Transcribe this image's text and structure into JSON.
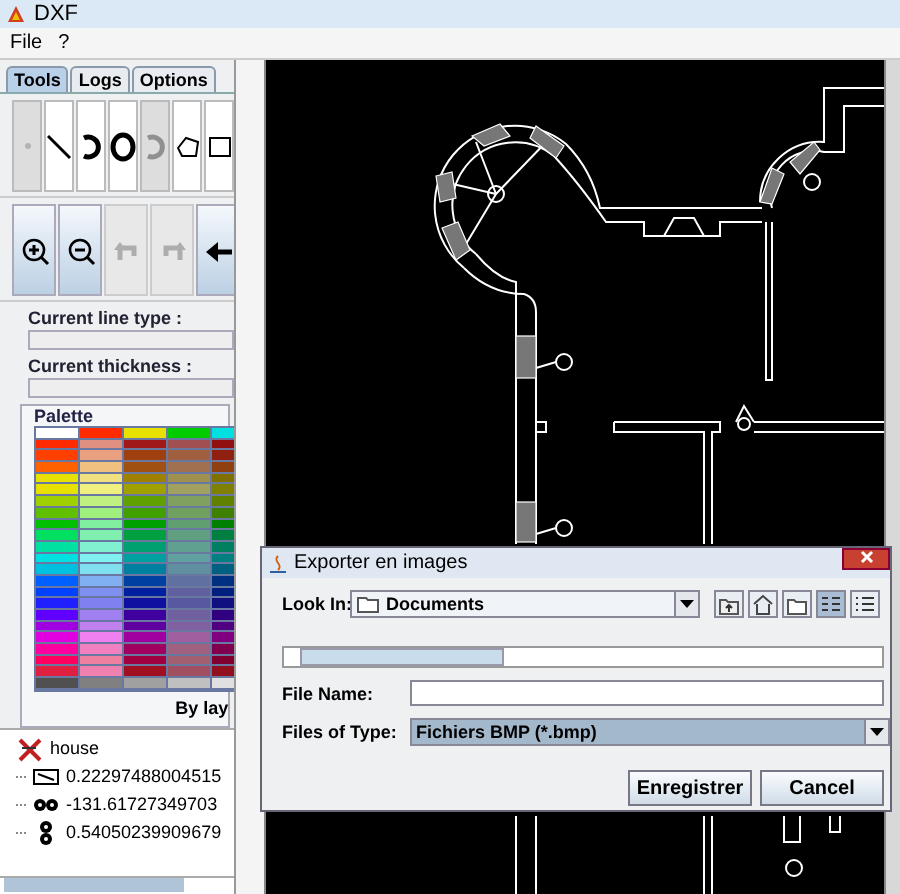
{
  "window": {
    "title": "DXF"
  },
  "menu": [
    {
      "label": "File"
    },
    {
      "label": "?"
    }
  ],
  "tabs": [
    {
      "label": "Tools",
      "selected": true
    },
    {
      "label": "Logs",
      "selected": false
    },
    {
      "label": "Options",
      "selected": false
    }
  ],
  "draw_tools": [
    {
      "kind": "point",
      "disabled": true
    },
    {
      "kind": "line",
      "disabled": false
    },
    {
      "kind": "arc",
      "disabled": false
    },
    {
      "kind": "circle",
      "disabled": false
    },
    {
      "kind": "arc",
      "disabled": true
    },
    {
      "kind": "polygon",
      "disabled": false
    },
    {
      "kind": "rectangle",
      "disabled": false
    }
  ],
  "view_tools": [
    {
      "kind": "zoom-in",
      "disabled": false
    },
    {
      "kind": "zoom-out",
      "disabled": false
    },
    {
      "kind": "undo",
      "disabled": true
    },
    {
      "kind": "redo",
      "disabled": true
    },
    {
      "kind": "arrow",
      "disabled": false
    }
  ],
  "properties": [
    {
      "label": "Current line type :"
    },
    {
      "label": "Current thickness :"
    }
  ],
  "palette": {
    "title": "Palette",
    "footer": "By lay",
    "rows": [
      [
        {
          "color": "#ffffff"
        },
        {
          "color": "#ff2a00"
        },
        {
          "color": "#e8e000"
        },
        {
          "color": "#00cc00"
        },
        {
          "color": "#00e0e0"
        }
      ],
      [
        {
          "color": "#ff2a00"
        },
        {
          "color": "#e09080"
        },
        {
          "color": "#a01818"
        },
        {
          "color": "#a05050"
        },
        {
          "color": "#901010"
        }
      ],
      [
        {
          "color": "#ff4000"
        },
        {
          "color": "#e8a080"
        },
        {
          "color": "#a04010"
        },
        {
          "color": "#a06040"
        },
        {
          "color": "#902010"
        }
      ],
      [
        {
          "color": "#ff6000"
        },
        {
          "color": "#f0c080"
        },
        {
          "color": "#a05010"
        },
        {
          "color": "#a07050"
        },
        {
          "color": "#904010"
        }
      ],
      [
        {
          "color": "#e8e000"
        },
        {
          "color": "#f0e080"
        },
        {
          "color": "#a08000"
        },
        {
          "color": "#a09050"
        },
        {
          "color": "#807000"
        }
      ],
      [
        {
          "color": "#e8e000"
        },
        {
          "color": "#f0f080"
        },
        {
          "color": "#a0a000"
        },
        {
          "color": "#a0a060"
        },
        {
          "color": "#808000"
        }
      ],
      [
        {
          "color": "#a0d000"
        },
        {
          "color": "#c0f080"
        },
        {
          "color": "#60a000"
        },
        {
          "color": "#80a060"
        },
        {
          "color": "#608000"
        }
      ],
      [
        {
          "color": "#60c000"
        },
        {
          "color": "#a0f080"
        },
        {
          "color": "#40a000"
        },
        {
          "color": "#70a060"
        },
        {
          "color": "#408000"
        }
      ],
      [
        {
          "color": "#00c000"
        },
        {
          "color": "#80f0a0"
        },
        {
          "color": "#00a000"
        },
        {
          "color": "#60a070"
        },
        {
          "color": "#008000"
        }
      ],
      [
        {
          "color": "#00e060"
        },
        {
          "color": "#80f0b0"
        },
        {
          "color": "#00a040"
        },
        {
          "color": "#60a080"
        },
        {
          "color": "#008040"
        }
      ],
      [
        {
          "color": "#00e0a0"
        },
        {
          "color": "#80f0d0"
        },
        {
          "color": "#00a070"
        },
        {
          "color": "#60a090"
        },
        {
          "color": "#008060"
        }
      ],
      [
        {
          "color": "#00e0e0"
        },
        {
          "color": "#80f0f0"
        },
        {
          "color": "#00a0a0"
        },
        {
          "color": "#60a0a0"
        },
        {
          "color": "#008080"
        }
      ],
      [
        {
          "color": "#00c0e0"
        },
        {
          "color": "#80e0f0"
        },
        {
          "color": "#0080a0"
        },
        {
          "color": "#6090a0"
        },
        {
          "color": "#006080"
        }
      ],
      [
        {
          "color": "#0060ff"
        },
        {
          "color": "#80b0f0"
        },
        {
          "color": "#0040a0"
        },
        {
          "color": "#6070a0"
        },
        {
          "color": "#003080"
        }
      ],
      [
        {
          "color": "#0040ff"
        },
        {
          "color": "#8090f0"
        },
        {
          "color": "#0020a0"
        },
        {
          "color": "#6060a0"
        },
        {
          "color": "#002080"
        }
      ],
      [
        {
          "color": "#2020ff"
        },
        {
          "color": "#8080f0"
        },
        {
          "color": "#1010a0"
        },
        {
          "color": "#5858a0"
        },
        {
          "color": "#101080"
        }
      ],
      [
        {
          "color": "#6000ff"
        },
        {
          "color": "#a080f0"
        },
        {
          "color": "#4000a0"
        },
        {
          "color": "#7060a0"
        },
        {
          "color": "#300080"
        }
      ],
      [
        {
          "color": "#a000e0"
        },
        {
          "color": "#c080f0"
        },
        {
          "color": "#6000a0"
        },
        {
          "color": "#8060a0"
        },
        {
          "color": "#500080"
        }
      ],
      [
        {
          "color": "#e000e0"
        },
        {
          "color": "#f080f0"
        },
        {
          "color": "#a000a0"
        },
        {
          "color": "#a060a0"
        },
        {
          "color": "#800080"
        }
      ],
      [
        {
          "color": "#ff00a0"
        },
        {
          "color": "#f080c0"
        },
        {
          "color": "#a00060"
        },
        {
          "color": "#a06080"
        },
        {
          "color": "#800050"
        }
      ],
      [
        {
          "color": "#ff0060"
        },
        {
          "color": "#f080a0"
        },
        {
          "color": "#a00040"
        },
        {
          "color": "#a06070"
        },
        {
          "color": "#800030"
        }
      ],
      [
        {
          "color": "#e02040"
        },
        {
          "color": "#f080b0"
        },
        {
          "color": "#a01020"
        },
        {
          "color": "#a05060"
        },
        {
          "color": "#901020"
        }
      ],
      [
        {
          "color": "#505050"
        },
        {
          "color": "#808080"
        },
        {
          "color": "#a0a0a0"
        },
        {
          "color": "#c0c0c0"
        },
        {
          "color": "#e0e0e0"
        }
      ]
    ]
  },
  "tree": {
    "label": "house",
    "children": [
      {
        "kind": "rect",
        "label": "0.22297488004515"
      },
      {
        "kind": "chain",
        "label": "-131.61727349703"
      },
      {
        "kind": "stack",
        "label": "0.54050239909679"
      }
    ]
  },
  "dialog": {
    "title": "Exporter en images",
    "look_in_label": "Look In:",
    "look_in_value": "Documents",
    "view_buttons": [
      {
        "kind": "up-folder",
        "selected": false
      },
      {
        "kind": "home",
        "selected": false
      },
      {
        "kind": "new-folder",
        "selected": false
      },
      {
        "kind": "list",
        "selected": true
      },
      {
        "kind": "details",
        "selected": false
      }
    ],
    "file_name_label": "File Name:",
    "file_type_label": "Files of Type:",
    "file_type_value": "Fichiers BMP (*.bmp)",
    "buttons": [
      {
        "label": "Enregistrer"
      },
      {
        "label": "Cancel"
      }
    ]
  }
}
